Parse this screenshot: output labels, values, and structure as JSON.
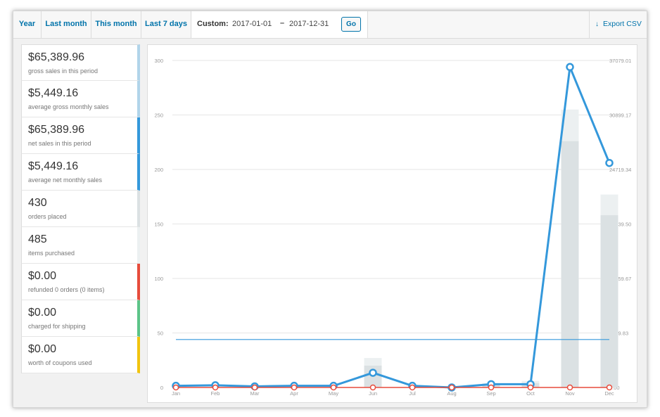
{
  "tabs": [
    {
      "label": "Year"
    },
    {
      "label": "Last month"
    },
    {
      "label": "This month"
    },
    {
      "label": "Last 7 days"
    }
  ],
  "custom": {
    "label": "Custom:",
    "start_date": "2017-01-01",
    "separator": "–",
    "end_date": "2017-12-31",
    "go_label": "Go"
  },
  "export": {
    "label": "Export CSV",
    "icon": "download-arrow-icon"
  },
  "legend": [
    {
      "value": "$65,389.96",
      "desc": "gross sales in this period",
      "color": "#b1d4ea"
    },
    {
      "value": "$5,449.16",
      "desc": "average gross monthly sales",
      "color": "#b1d4ea"
    },
    {
      "value": "$65,389.96",
      "desc": "net sales in this period",
      "color": "#3498db"
    },
    {
      "value": "$5,449.16",
      "desc": "average net monthly sales",
      "color": "#3498db"
    },
    {
      "value": "430",
      "desc": "orders placed",
      "color": "#dbe1e3"
    },
    {
      "value": "485",
      "desc": "items purchased",
      "color": "#ecf0f1"
    },
    {
      "value": "$0.00",
      "desc": "refunded 0 orders (0 items)",
      "color": "#e74c3c"
    },
    {
      "value": "$0.00",
      "desc": "charged for shipping",
      "color": "#5cc488"
    },
    {
      "value": "$0.00",
      "desc": "worth of coupons used",
      "color": "#f1c40f"
    }
  ],
  "chart_data": {
    "type": "line",
    "categories": [
      "Jan",
      "Feb",
      "Mar",
      "Apr",
      "May",
      "Jun",
      "Jul",
      "Aug",
      "Sep",
      "Oct",
      "Nov",
      "Dec"
    ],
    "y_left": {
      "ticks": [
        "0",
        "50",
        "100",
        "150",
        "200",
        "250",
        "300"
      ],
      "range": [
        0,
        300
      ]
    },
    "y_right": {
      "ticks": [
        "0.00",
        "6179.83",
        "12359.67",
        "18539.50",
        "24719.34",
        "30899.17",
        "37079.01"
      ],
      "range": [
        0,
        37079.01
      ]
    },
    "grid": true,
    "series": [
      {
        "type": "bar",
        "values": [
          0,
          0,
          0,
          0,
          0,
          27,
          0,
          0,
          4,
          6,
          255,
          177
        ],
        "color": "#ecf0f1"
      },
      {
        "type": "bar",
        "values": [
          0,
          0,
          0,
          0,
          0,
          20,
          0,
          0,
          3,
          4,
          226,
          158
        ],
        "color": "#dbe1e3"
      },
      {
        "type": "line",
        "values": [
          1.5,
          2,
          1,
          1.5,
          1.5,
          13.5,
          1.5,
          0,
          3,
          3,
          294,
          206
        ],
        "color": "#3498db",
        "markers": true
      },
      {
        "type": "line",
        "values": [
          0,
          0,
          0,
          0,
          0,
          0,
          0,
          0,
          0,
          0,
          0,
          0
        ],
        "color": "#e74c3c",
        "markers": true
      },
      {
        "type": "line",
        "values": [
          44,
          44,
          44,
          44,
          44,
          44,
          44,
          44,
          44,
          44,
          44,
          44
        ],
        "color": "#3498db",
        "markers": false
      }
    ]
  }
}
